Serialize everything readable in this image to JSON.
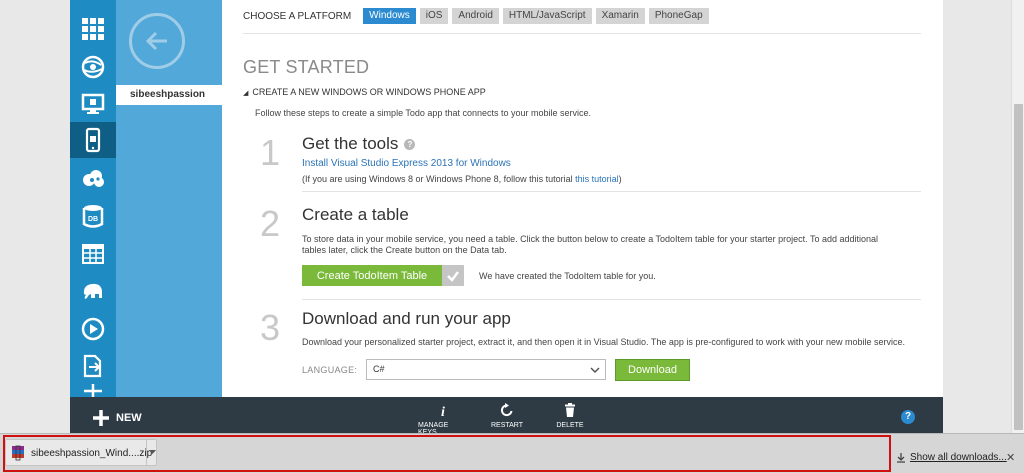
{
  "nav": {
    "rail_icons": [
      "grid-icon",
      "globe-icon",
      "monitor-icon",
      "mobile-icon",
      "cloud-services-icon",
      "database-icon",
      "table-icon",
      "elephant-icon",
      "media-icon",
      "document-export-icon",
      "more-icon"
    ],
    "panel_item": "sibeeshpassion"
  },
  "platform": {
    "label": "CHOOSE A PLATFORM",
    "tabs": [
      "Windows",
      "iOS",
      "Android",
      "HTML/JavaScript",
      "Xamarin",
      "PhoneGap"
    ],
    "active": "Windows"
  },
  "content": {
    "heading": "GET STARTED",
    "section": "CREATE A NEW WINDOWS OR WINDOWS PHONE APP",
    "intro": "Follow these steps to create a simple Todo app that connects to your mobile service.",
    "step1": {
      "number": "1",
      "title": "Get the tools",
      "link": "Install Visual Studio Express 2013 for Windows",
      "note_prefix": "(If you are using Windows 8 or Windows Phone 8, follow this tutorial ",
      "note_link": "this tutorial",
      "note_suffix": ")"
    },
    "step2": {
      "number": "2",
      "title": "Create a table",
      "line1": "To store data in your mobile service, you need a table. Click the button below to create a TodoItem table for your starter project. To add additional",
      "line2": "tables later, click the Create button on the Data tab.",
      "button": "Create TodoItem Table",
      "message": "We have created the TodoItem table for you."
    },
    "step3": {
      "number": "3",
      "title": "Download and run your app",
      "line1": "Download your personalized starter project, extract it, and then open it in Visual Studio. The app is pre-configured to work with your new mobile service.",
      "language_label": "LANGUAGE:",
      "language_value": "C#",
      "button": "Download"
    }
  },
  "commandbar": {
    "new": "NEW",
    "manage_keys": "MANAGE KEYS",
    "restart": "RESTART",
    "delete": "DELETE",
    "help": "?"
  },
  "downloads": {
    "file_name": "sibeeshpassion_Wind....zip",
    "show_all": "Show all downloads...",
    "close": "✕"
  },
  "colors": {
    "rail": "#1e8bc3",
    "panel": "#52a8d8",
    "accent_green": "#7ab939",
    "active_tab": "#2b8ad0",
    "command_bar": "#2e3b44",
    "highlight": "#d01010"
  }
}
